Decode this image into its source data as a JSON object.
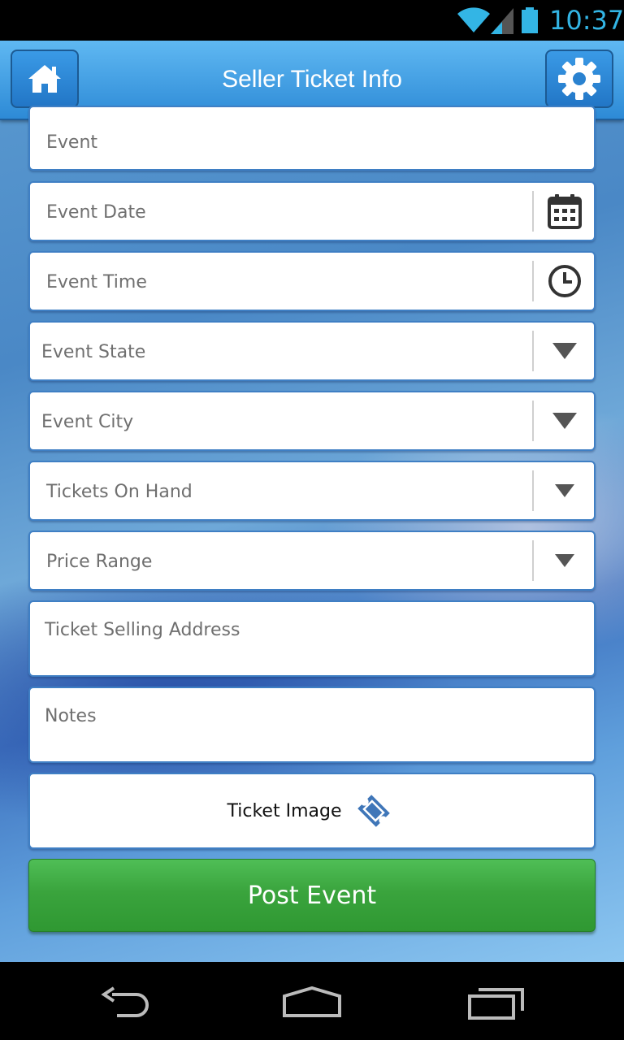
{
  "status_bar": {
    "time": "10:37",
    "accent": "#33b5e5"
  },
  "header": {
    "title": "Seller Ticket Info",
    "home_icon": "home-icon",
    "settings_icon": "gear-icon",
    "color": "#2d8ad6"
  },
  "form": {
    "event_placeholder": "Event",
    "event_date_placeholder": "Event Date",
    "event_time_placeholder": "Event Time",
    "event_state_placeholder": "Event State",
    "event_city_placeholder": "Event City",
    "tickets_on_hand_placeholder": "Tickets On Hand",
    "price_range_placeholder": "Price Range",
    "ticket_selling_address_placeholder": "Ticket Selling Address",
    "notes_placeholder": "Notes",
    "ticket_image_label": "Ticket Image",
    "post_button_label": "Post Event",
    "post_button_color": "#3aa43d"
  },
  "nav_bar": {
    "icons": [
      "back-icon",
      "home-icon",
      "recent-apps-icon"
    ]
  }
}
